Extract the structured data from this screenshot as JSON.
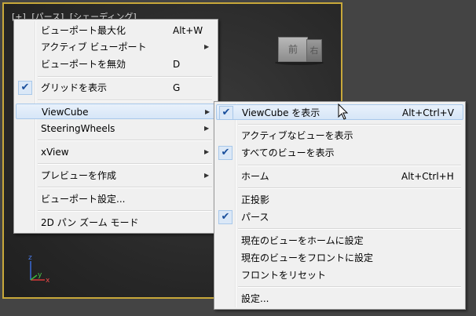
{
  "viewport": {
    "label_parts": [
      "[+]",
      "[パース]",
      "[シェーディング]"
    ],
    "viewcube": {
      "front": "前",
      "right": "右"
    },
    "axis": {
      "x": "x",
      "y": "y",
      "z": "z"
    }
  },
  "menu_main": {
    "items": [
      {
        "label": "ビューポート最大化",
        "shortcut": "Alt+W"
      },
      {
        "label": "アクティブ ビューポート",
        "submenu": true
      },
      {
        "label": "ビューポートを無効",
        "shortcut": "D"
      },
      {
        "label": "グリッドを表示",
        "shortcut": "G",
        "checked": true
      },
      {
        "label": "ViewCube",
        "submenu": true,
        "highlighted": true
      },
      {
        "label": "SteeringWheels",
        "submenu": true
      },
      {
        "label": "xView",
        "submenu": true
      },
      {
        "label": "プレビューを作成",
        "submenu": true
      },
      {
        "label": "ビューポート設定..."
      },
      {
        "label": "2D パン ズーム モード"
      }
    ]
  },
  "menu_viewcube": {
    "items": [
      {
        "label": "ViewCube を表示",
        "shortcut": "Alt+Ctrl+V",
        "checked": true,
        "highlighted": true
      },
      {
        "label": "アクティブなビューを表示"
      },
      {
        "label": "すべてのビューを表示",
        "checked": true
      },
      {
        "label": "ホーム",
        "shortcut": "Alt+Ctrl+H"
      },
      {
        "label": "正投影"
      },
      {
        "label": "パース",
        "checked": true
      },
      {
        "label": "現在のビューをホームに設定"
      },
      {
        "label": "現在のビューをフロントに設定"
      },
      {
        "label": "フロントをリセット"
      },
      {
        "label": "設定..."
      }
    ]
  },
  "check_glyph": "✔",
  "arrow_glyph": "▶",
  "colors": {
    "viewport_border": "#c8a83a",
    "menu_bg": "#f0f0f0",
    "highlight": "#d7e6f7",
    "check": "#1a4f9c"
  }
}
